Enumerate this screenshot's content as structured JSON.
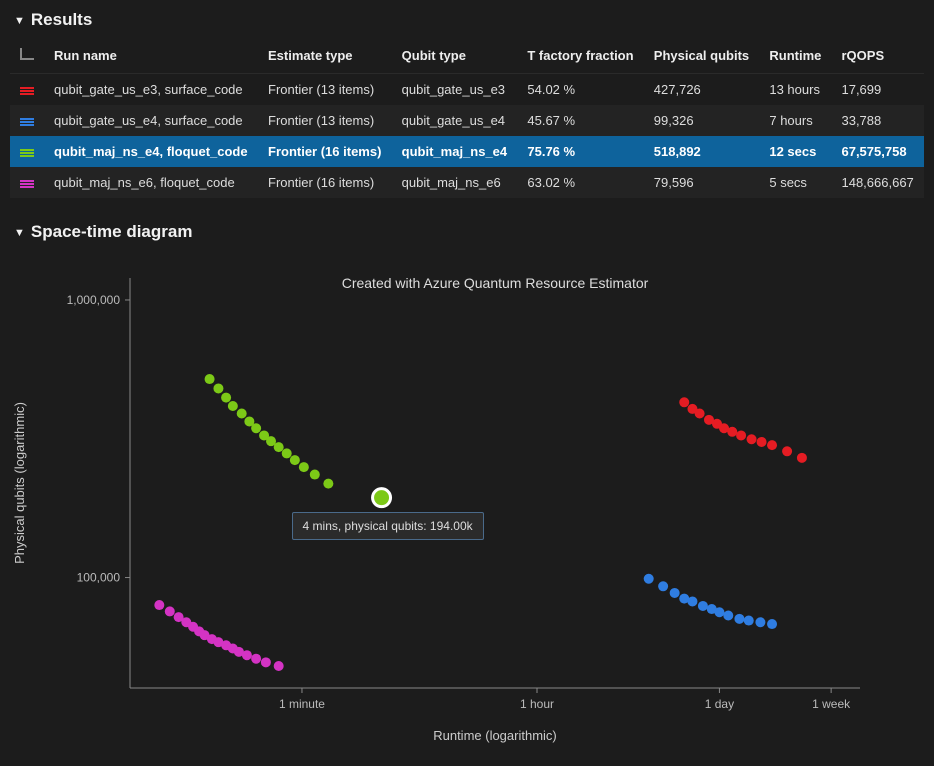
{
  "sections": {
    "results_title": "Results",
    "diagram_title": "Space-time diagram"
  },
  "table": {
    "headers": [
      "Run name",
      "Estimate type",
      "Qubit type",
      "T factory fraction",
      "Physical qubits",
      "Runtime",
      "rQOPS"
    ],
    "rows": [
      {
        "color": "#e51c23",
        "run_name": "qubit_gate_us_e3, surface_code",
        "estimate_type": "Frontier (13 items)",
        "qubit_type": "qubit_gate_us_e3",
        "t_fraction": "54.02 %",
        "phys_qubits": "427,726",
        "runtime": "13 hours",
        "rqops": "17,699",
        "selected": false,
        "alt": false
      },
      {
        "color": "#2f7de1",
        "run_name": "qubit_gate_us_e4, surface_code",
        "estimate_type": "Frontier (13 items)",
        "qubit_type": "qubit_gate_us_e4",
        "t_fraction": "45.67 %",
        "phys_qubits": "99,326",
        "runtime": "7 hours",
        "rqops": "33,788",
        "selected": false,
        "alt": true
      },
      {
        "color": "#7cc917",
        "run_name": "qubit_maj_ns_e4, floquet_code",
        "estimate_type": "Frontier (16 items)",
        "qubit_type": "qubit_maj_ns_e4",
        "t_fraction": "75.76 %",
        "phys_qubits": "518,892",
        "runtime": "12 secs",
        "rqops": "67,575,758",
        "selected": true,
        "alt": false
      },
      {
        "color": "#d433c4",
        "run_name": "qubit_maj_ns_e6, floquet_code",
        "estimate_type": "Frontier (16 items)",
        "qubit_type": "qubit_maj_ns_e6",
        "t_fraction": "63.02 %",
        "phys_qubits": "79,596",
        "runtime": "5 secs",
        "rqops": "148,666,667",
        "selected": false,
        "alt": true
      }
    ]
  },
  "chart_data": {
    "type": "scatter",
    "title": "Created with Azure Quantum Resource Estimator",
    "xlabel": "Runtime (logarithmic)",
    "ylabel": "Physical qubits (logarithmic)",
    "x_ticks": [
      {
        "label": "1 minute",
        "value_sec": 60
      },
      {
        "label": "1 hour",
        "value_sec": 3600
      },
      {
        "label": "1 day",
        "value_sec": 86400
      },
      {
        "label": "1 week",
        "value_sec": 604800
      }
    ],
    "y_ticks": [
      {
        "label": "100,000",
        "value": 100000
      },
      {
        "label": "1,000,000",
        "value": 1000000
      }
    ],
    "xlim_sec": [
      3,
      1000000
    ],
    "ylim": [
      40000,
      1200000
    ],
    "highlight": {
      "series": "qubit_maj_ns_e4",
      "runtime_sec": 240,
      "runtime_label": "4 mins",
      "physical_qubits": 194000,
      "physical_qubits_label": "194.00k",
      "tooltip_text": "4 mins, physical qubits: 194.00k"
    },
    "series": [
      {
        "name": "qubit_gate_us_e3",
        "color": "#e51c23",
        "points": [
          {
            "runtime_sec": 46800,
            "physical_qubits": 428000
          },
          {
            "runtime_sec": 54000,
            "physical_qubits": 405000
          },
          {
            "runtime_sec": 61200,
            "physical_qubits": 390000
          },
          {
            "runtime_sec": 72000,
            "physical_qubits": 370000
          },
          {
            "runtime_sec": 82800,
            "physical_qubits": 358000
          },
          {
            "runtime_sec": 93600,
            "physical_qubits": 345000
          },
          {
            "runtime_sec": 108000,
            "physical_qubits": 335000
          },
          {
            "runtime_sec": 126000,
            "physical_qubits": 325000
          },
          {
            "runtime_sec": 151200,
            "physical_qubits": 315000
          },
          {
            "runtime_sec": 180000,
            "physical_qubits": 308000
          },
          {
            "runtime_sec": 216000,
            "physical_qubits": 300000
          },
          {
            "runtime_sec": 280800,
            "physical_qubits": 285000
          },
          {
            "runtime_sec": 363600,
            "physical_qubits": 270000
          }
        ]
      },
      {
        "name": "qubit_gate_us_e4",
        "color": "#2f7de1",
        "points": [
          {
            "runtime_sec": 25200,
            "physical_qubits": 99000
          },
          {
            "runtime_sec": 32400,
            "physical_qubits": 93000
          },
          {
            "runtime_sec": 39600,
            "physical_qubits": 88000
          },
          {
            "runtime_sec": 46800,
            "physical_qubits": 84000
          },
          {
            "runtime_sec": 54000,
            "physical_qubits": 82000
          },
          {
            "runtime_sec": 64800,
            "physical_qubits": 79000
          },
          {
            "runtime_sec": 75600,
            "physical_qubits": 77000
          },
          {
            "runtime_sec": 86400,
            "physical_qubits": 75000
          },
          {
            "runtime_sec": 100800,
            "physical_qubits": 73000
          },
          {
            "runtime_sec": 122400,
            "physical_qubits": 71000
          },
          {
            "runtime_sec": 144000,
            "physical_qubits": 70000
          },
          {
            "runtime_sec": 176400,
            "physical_qubits": 69000
          },
          {
            "runtime_sec": 216000,
            "physical_qubits": 68000
          }
        ]
      },
      {
        "name": "qubit_maj_ns_e4",
        "color": "#7cc917",
        "points": [
          {
            "runtime_sec": 12,
            "physical_qubits": 519000
          },
          {
            "runtime_sec": 14,
            "physical_qubits": 480000
          },
          {
            "runtime_sec": 16,
            "physical_qubits": 445000
          },
          {
            "runtime_sec": 18,
            "physical_qubits": 415000
          },
          {
            "runtime_sec": 21,
            "physical_qubits": 390000
          },
          {
            "runtime_sec": 24,
            "physical_qubits": 365000
          },
          {
            "runtime_sec": 27,
            "physical_qubits": 345000
          },
          {
            "runtime_sec": 31,
            "physical_qubits": 325000
          },
          {
            "runtime_sec": 35,
            "physical_qubits": 310000
          },
          {
            "runtime_sec": 40,
            "physical_qubits": 295000
          },
          {
            "runtime_sec": 46,
            "physical_qubits": 280000
          },
          {
            "runtime_sec": 53,
            "physical_qubits": 265000
          },
          {
            "runtime_sec": 62,
            "physical_qubits": 250000
          },
          {
            "runtime_sec": 75,
            "physical_qubits": 235000
          },
          {
            "runtime_sec": 95,
            "physical_qubits": 218000
          },
          {
            "runtime_sec": 240,
            "physical_qubits": 194000
          }
        ]
      },
      {
        "name": "qubit_maj_ns_e6",
        "color": "#d433c4",
        "points": [
          {
            "runtime_sec": 5,
            "physical_qubits": 79600
          },
          {
            "runtime_sec": 6,
            "physical_qubits": 75500
          },
          {
            "runtime_sec": 7,
            "physical_qubits": 72000
          },
          {
            "runtime_sec": 8,
            "physical_qubits": 69000
          },
          {
            "runtime_sec": 9,
            "physical_qubits": 66500
          },
          {
            "runtime_sec": 10,
            "physical_qubits": 64000
          },
          {
            "runtime_sec": 11,
            "physical_qubits": 62000
          },
          {
            "runtime_sec": 12.5,
            "physical_qubits": 60000
          },
          {
            "runtime_sec": 14,
            "physical_qubits": 58500
          },
          {
            "runtime_sec": 16,
            "physical_qubits": 57000
          },
          {
            "runtime_sec": 18,
            "physical_qubits": 55500
          },
          {
            "runtime_sec": 20,
            "physical_qubits": 54000
          },
          {
            "runtime_sec": 23,
            "physical_qubits": 52500
          },
          {
            "runtime_sec": 27,
            "physical_qubits": 51000
          },
          {
            "runtime_sec": 32,
            "physical_qubits": 49500
          },
          {
            "runtime_sec": 40,
            "physical_qubits": 48000
          }
        ]
      }
    ]
  }
}
